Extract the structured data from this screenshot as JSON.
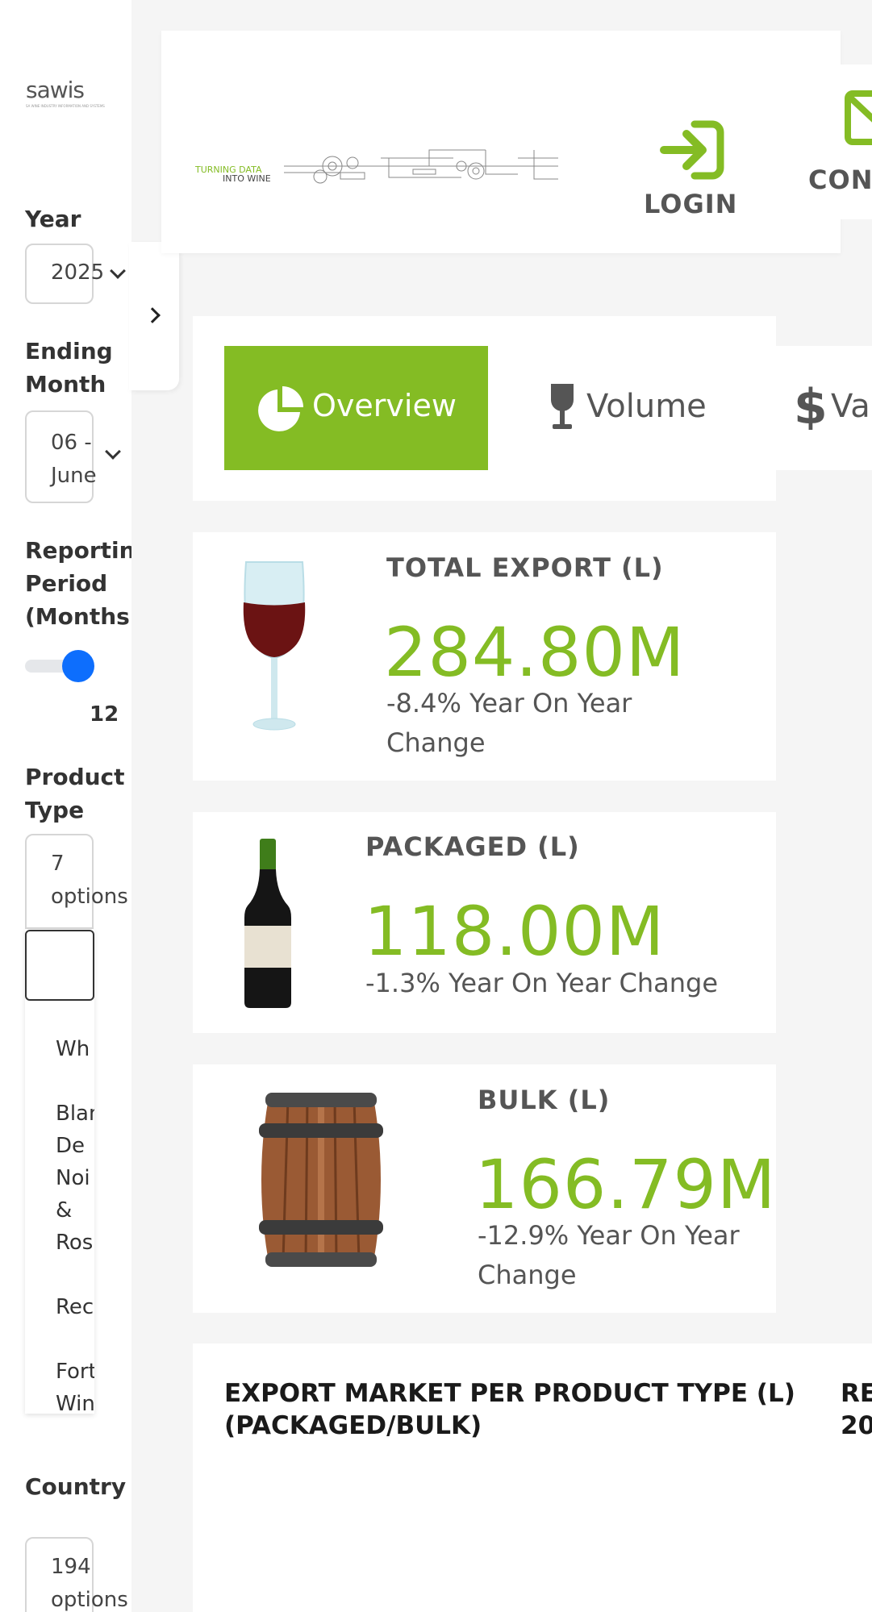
{
  "sidebar": {
    "logo": {
      "text": "sawis",
      "tagline": "SA WINE INDUSTRY INFORMATION AND SYSTEMS"
    },
    "year": {
      "label": "Year",
      "value": "2025"
    },
    "ending_month": {
      "label_line1": "Ending",
      "label_line2": "Month",
      "value_line1": "06 -",
      "value_line2": "June"
    },
    "reporting_period": {
      "label_line1": "Reportin",
      "label_line2": "Period",
      "label_line3": "(Months)",
      "value": "12"
    },
    "product_type": {
      "label_line1": "Product",
      "label_line2": "Type",
      "value_line1": "7",
      "value_line2": "options",
      "options": [
        {
          "lines": [
            "Wh"
          ]
        },
        {
          "lines": [
            "Blan",
            "De",
            "Noi",
            "&",
            "Ros"
          ]
        },
        {
          "lines": [
            "Rec"
          ]
        },
        {
          "lines": [
            "Fort",
            "Win"
          ]
        }
      ]
    },
    "country": {
      "label": "Country",
      "value_line1": "194",
      "value_line2": "options"
    }
  },
  "banner": {
    "tagline_line1": "TURNING DATA",
    "tagline_line2": "INTO WINE",
    "login_label": "LOGIN",
    "contact_label": "CON"
  },
  "tabs": {
    "overview": "Overview",
    "volume": "Volume",
    "value": "Val"
  },
  "kpis": {
    "total": {
      "title": "TOTAL EXPORT (L)",
      "value": "284.80M",
      "change_line1": "-8.4% Year On Year",
      "change_line2": "Change"
    },
    "packaged": {
      "title": "PACKAGED (L)",
      "value": "118.00M",
      "change": "-1.3% Year On Year Change"
    },
    "bulk": {
      "title": "BULK (L)",
      "value": "166.79M",
      "change_line1": "-12.9% Year On Year",
      "change_line2": "Change"
    }
  },
  "chart_section": {
    "title_line1": "EXPORT MARKET PER PRODUCT TYPE (L)",
    "title_line2": "(PACKAGED/BULK)",
    "title2_line1": "RE",
    "title2_line2": "20"
  },
  "colors": {
    "accent": "#84bc24",
    "slider": "#0d6efd",
    "text": "#555555"
  }
}
